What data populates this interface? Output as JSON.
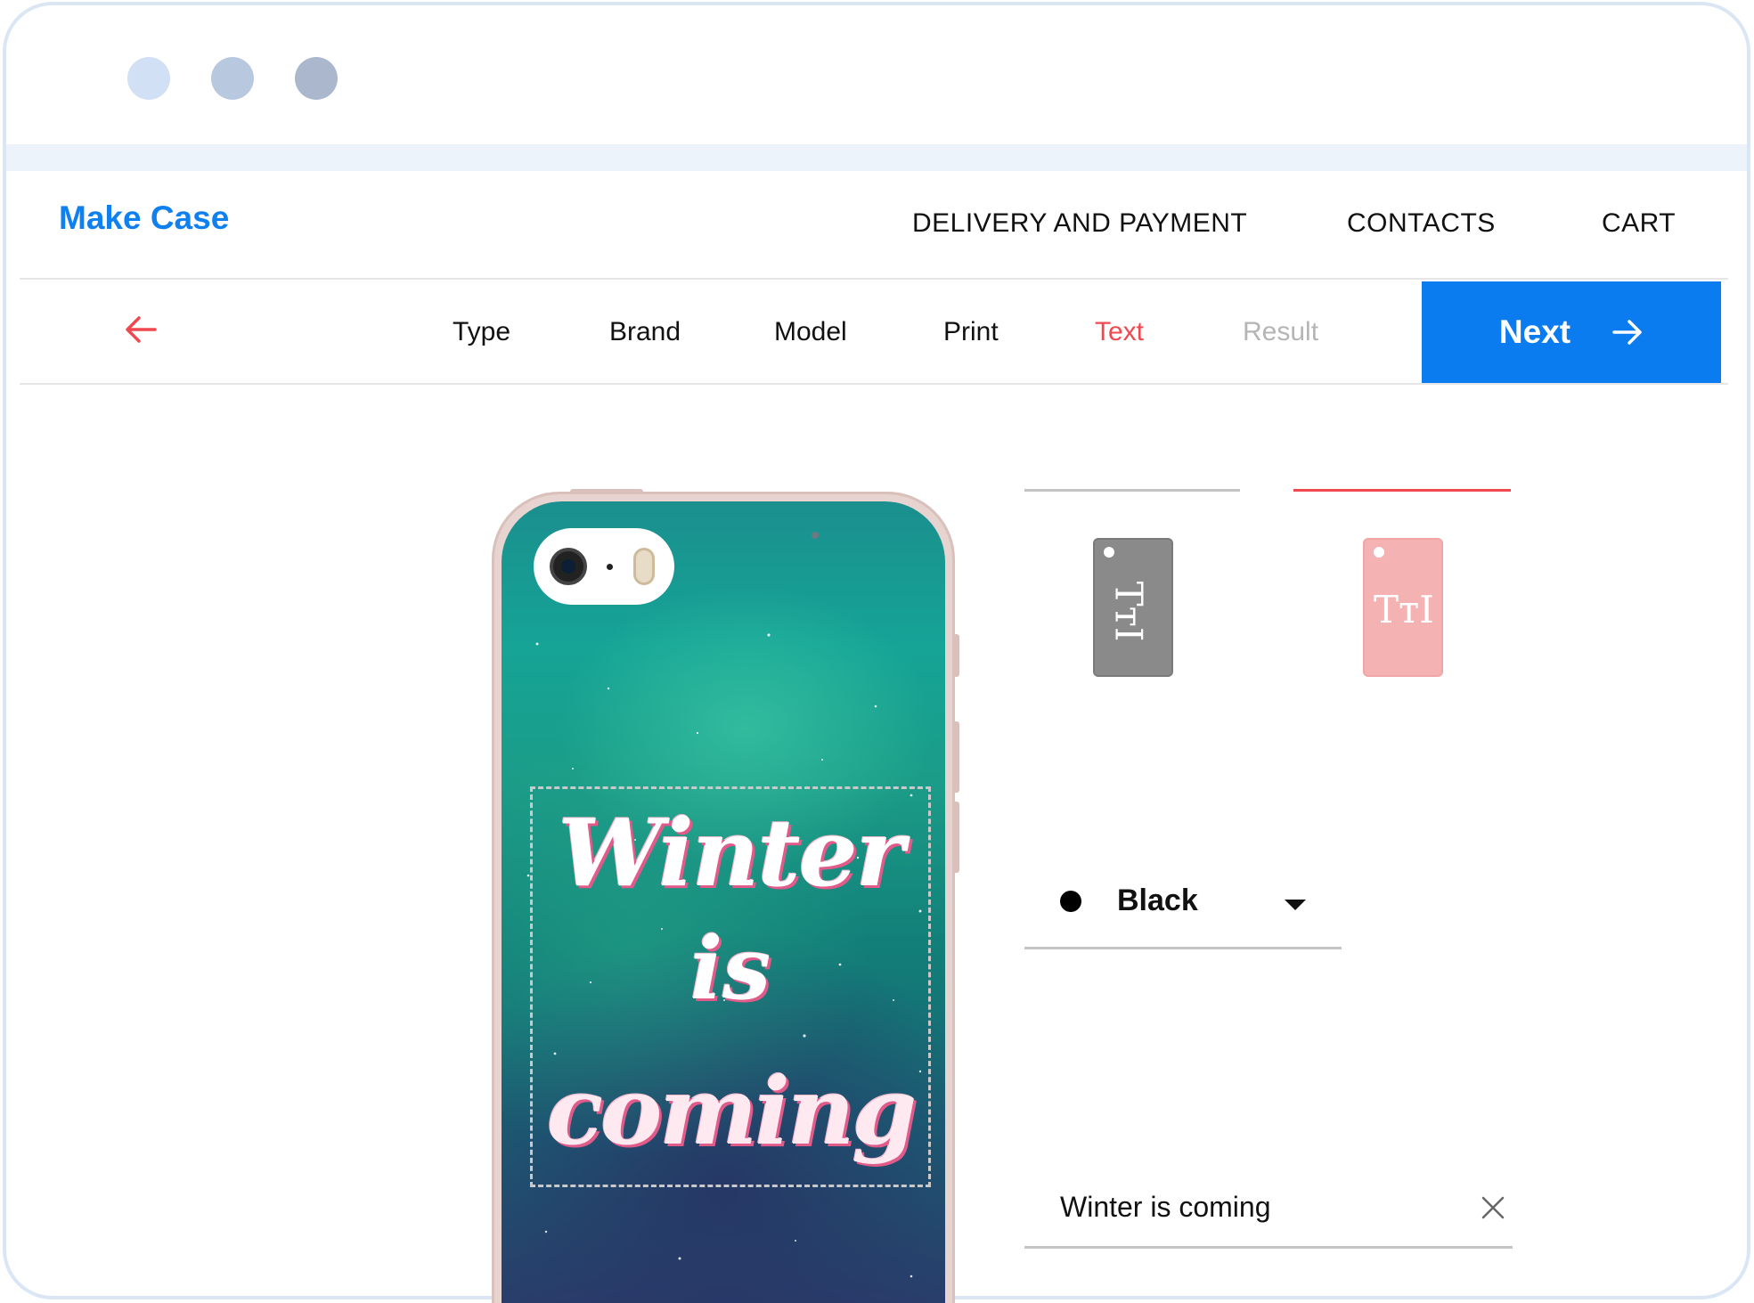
{
  "brand": {
    "name": "Make Case",
    "color": "#1080ef"
  },
  "nav": {
    "delivery": "DELIVERY AND PAYMENT",
    "contacts": "CONTACTS",
    "cart": "CART"
  },
  "steps": {
    "type": "Type",
    "brand": "Brand",
    "model": "Model",
    "print": "Print",
    "text": "Text",
    "result": "Result",
    "active": "Text",
    "active_color": "#f0484f"
  },
  "next_button": {
    "label": "Next",
    "icon": "arrow-right-icon",
    "color": "#0a7cf0"
  },
  "back_button": {
    "icon": "arrow-left-icon"
  },
  "case_preview": {
    "text_lines": [
      "Winter",
      "is",
      "coming"
    ]
  },
  "text_orientation": {
    "options": [
      {
        "icon": "text-vertical-icon",
        "glyph": "TтI",
        "selected": false
      },
      {
        "icon": "text-horizontal-icon",
        "glyph": "TтI",
        "selected": true
      }
    ]
  },
  "color_select": {
    "value": "Black",
    "swatch": "#000000"
  },
  "text_input": {
    "value": "Winter is coming",
    "clear_icon": "close-icon"
  }
}
